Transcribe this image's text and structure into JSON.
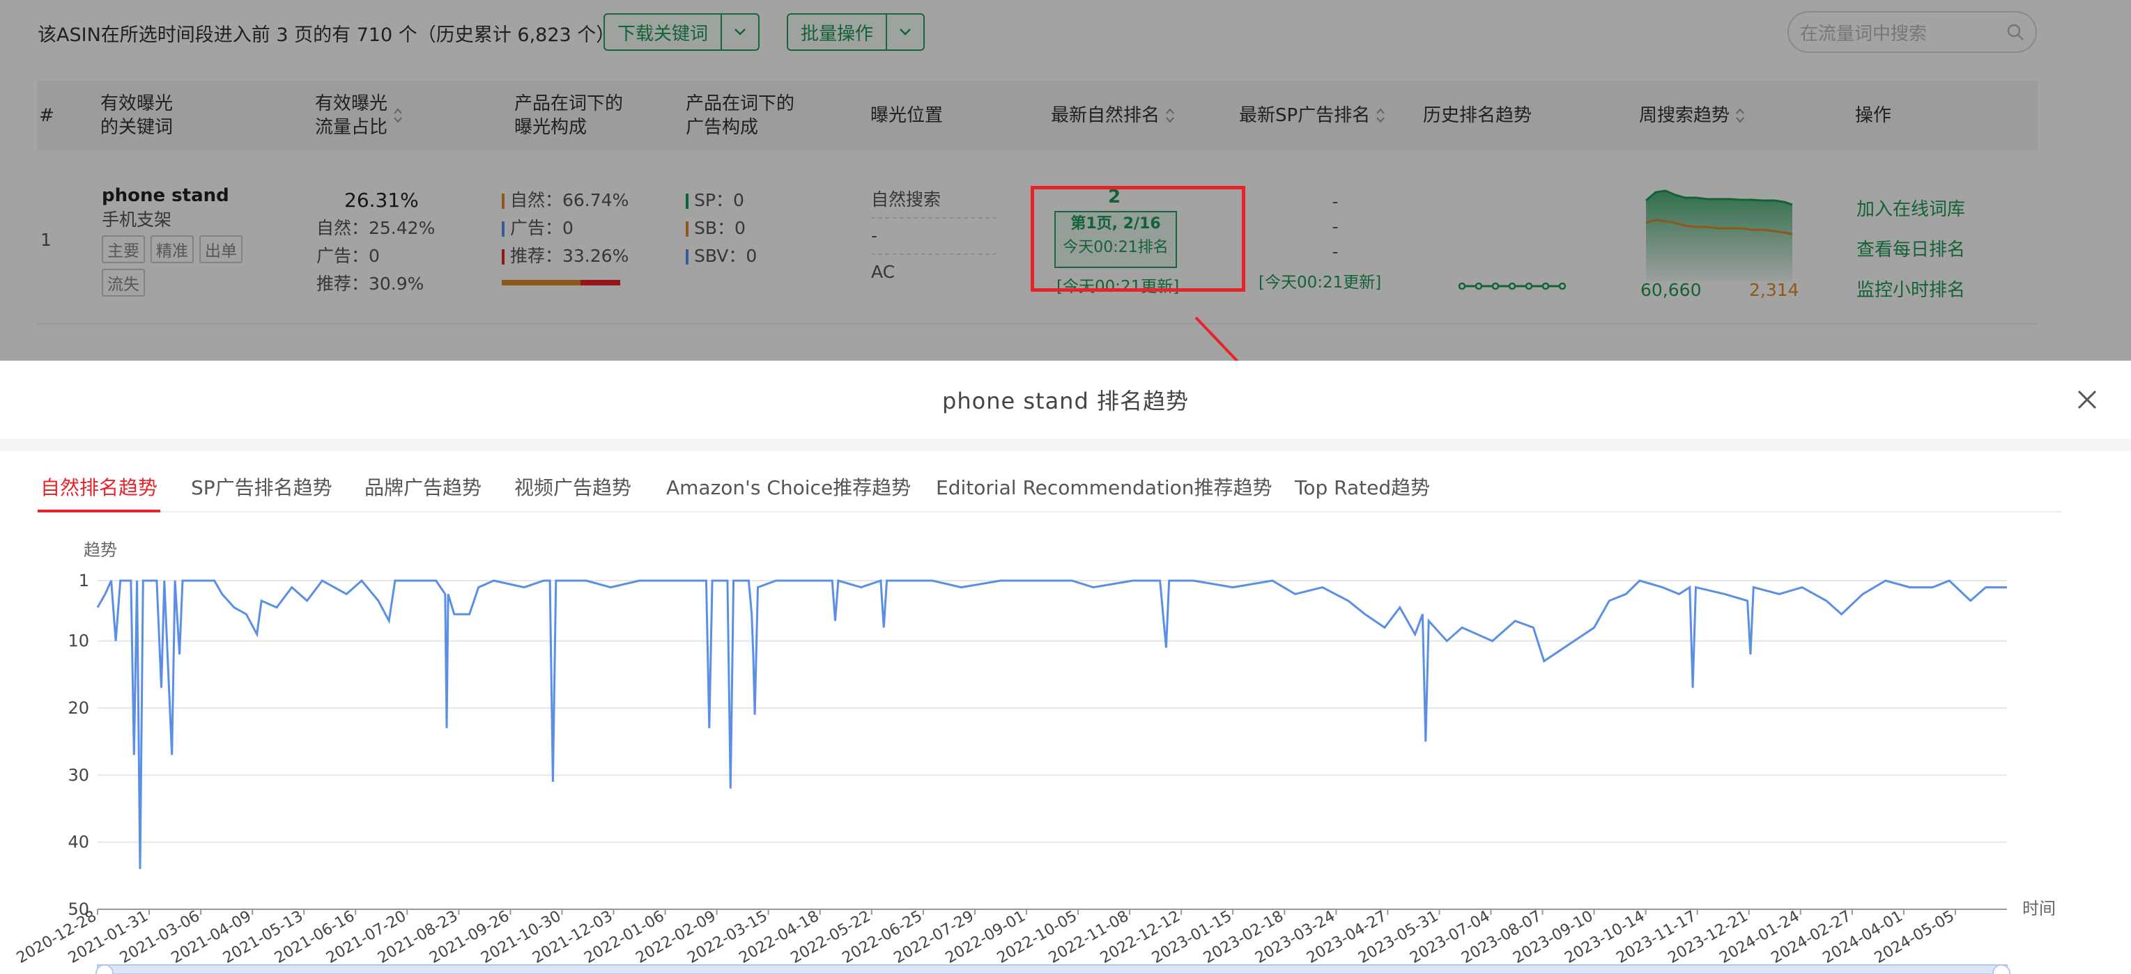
{
  "background": {
    "summary": "该ASIN在所选时间段进入前 3 页的有 710 个（历史累计 6,823 个）",
    "download_btn": "下载关键词",
    "batch_btn": "批量操作",
    "search_placeholder": "在流量词中搜索",
    "headers": [
      "#",
      "有效曝光\n的关键词",
      "有效曝光\n流量占比",
      "产品在词下的\n曝光构成",
      "产品在词下的\n广告构成",
      "曝光位置",
      "最新自然排名",
      "最新SP广告排名",
      "历史排名趋势",
      "周搜索趋势",
      "操作"
    ],
    "row": {
      "index": "1",
      "keyword": "phone stand",
      "keyword_cn": "手机支架",
      "tags": [
        "主要",
        "精准",
        "出单",
        "流失"
      ],
      "share": "26.31%",
      "share_natural": "自然：25.42%",
      "share_ad": "广告：0",
      "share_rec": "推荐：30.9%",
      "exp_natural": "自然：66.74%",
      "exp_ad": "广告：0",
      "exp_rec": "推荐：33.26%",
      "ad_sp": "SP：0",
      "ad_sb": "SB：0",
      "ad_sbv": "SBV：0",
      "pos_1": "自然搜索",
      "pos_2": "-",
      "pos_3": "AC",
      "rank_value": "2",
      "rank_page": "第1页, 2/16",
      "rank_time": "今天00:21排名",
      "rank_updated": "[今天00:21更新]",
      "sp_1": "-",
      "sp_2": "-",
      "sp_3": "-",
      "sp_updated": "[今天00:21更新]",
      "weekly_a": "60,660",
      "weekly_b": "2,314",
      "ops": [
        "加入在线词库",
        "查看每日排名",
        "监控小时排名"
      ]
    }
  },
  "modal": {
    "title": "phone stand 排名趋势",
    "tabs": [
      "自然排名趋势",
      "SP广告排名趋势",
      "品牌广告趋势",
      "视频广告趋势",
      "Amazon's Choice推荐趋势",
      "Editorial Recommendation推荐趋势",
      "Top Rated趋势"
    ],
    "active_tab": 0
  },
  "colors": {
    "accent_red": "#e8232a",
    "brand_green": "#1f9a55",
    "line_blue": "#5b8fe6",
    "orange": "#e08a2b"
  },
  "chart_data": {
    "type": "line",
    "ylabel": "趋势",
    "xlabel": "时间",
    "y_inverted": true,
    "yticks": [
      1,
      10,
      20,
      30,
      40,
      50
    ],
    "ylim": [
      1,
      50
    ],
    "xlim": [
      "2020-12-28",
      "2024-06-08"
    ],
    "xticks": [
      "2020-12-28",
      "2021-01-31",
      "2021-03-06",
      "2021-04-09",
      "2021-05-13",
      "2021-06-16",
      "2021-07-20",
      "2021-08-23",
      "2021-09-26",
      "2021-10-30",
      "2021-12-03",
      "2022-01-06",
      "2022-02-09",
      "2022-03-15",
      "2022-04-18",
      "2022-05-22",
      "2022-06-25",
      "2022-07-29",
      "2022-09-01",
      "2022-10-05",
      "2022-11-08",
      "2022-12-12",
      "2023-01-15",
      "2023-02-18",
      "2023-03-24",
      "2023-04-27",
      "2023-05-31",
      "2023-07-04",
      "2023-08-07",
      "2023-09-10",
      "2023-10-14",
      "2023-11-17",
      "2023-12-21",
      "2024-01-24",
      "2024-02-27",
      "2024-04-01",
      "2024-05-05"
    ],
    "grid": true,
    "series": [
      {
        "points": [
          [
            "2020-12-28",
            5
          ],
          [
            "2021-01-02",
            3
          ],
          [
            "2021-01-06",
            1
          ],
          [
            "2021-01-09",
            10
          ],
          [
            "2021-01-12",
            1
          ],
          [
            "2021-01-19",
            1
          ],
          [
            "2021-01-21",
            27
          ],
          [
            "2021-01-23",
            1
          ],
          [
            "2021-01-25",
            44
          ],
          [
            "2021-01-27",
            1
          ],
          [
            "2021-02-05",
            1
          ],
          [
            "2021-02-08",
            17
          ],
          [
            "2021-02-10",
            1
          ],
          [
            "2021-02-15",
            27
          ],
          [
            "2021-02-17",
            1
          ],
          [
            "2021-02-20",
            12
          ],
          [
            "2021-02-22",
            1
          ],
          [
            "2021-03-10",
            1
          ],
          [
            "2021-03-15",
            1
          ],
          [
            "2021-03-20",
            3
          ],
          [
            "2021-03-28",
            5
          ],
          [
            "2021-04-05",
            6
          ],
          [
            "2021-04-12",
            9
          ],
          [
            "2021-04-15",
            4
          ],
          [
            "2021-04-25",
            5
          ],
          [
            "2021-05-05",
            2
          ],
          [
            "2021-05-15",
            4
          ],
          [
            "2021-05-25",
            1
          ],
          [
            "2021-06-10",
            3
          ],
          [
            "2021-06-20",
            1
          ],
          [
            "2021-07-01",
            4
          ],
          [
            "2021-07-08",
            7
          ],
          [
            "2021-07-12",
            1
          ],
          [
            "2021-07-25",
            1
          ],
          [
            "2021-08-08",
            1
          ],
          [
            "2021-08-14",
            3
          ],
          [
            "2021-08-15",
            23
          ],
          [
            "2021-08-16",
            3
          ],
          [
            "2021-08-20",
            6
          ],
          [
            "2021-08-30",
            6
          ],
          [
            "2021-09-05",
            2
          ],
          [
            "2021-09-15",
            1
          ],
          [
            "2021-10-05",
            2
          ],
          [
            "2021-10-18",
            1
          ],
          [
            "2021-10-22",
            1
          ],
          [
            "2021-10-24",
            31
          ],
          [
            "2021-10-26",
            1
          ],
          [
            "2021-11-15",
            1
          ],
          [
            "2021-12-01",
            2
          ],
          [
            "2021-12-20",
            1
          ],
          [
            "2022-01-20",
            1
          ],
          [
            "2022-02-02",
            1
          ],
          [
            "2022-02-04",
            23
          ],
          [
            "2022-02-06",
            1
          ],
          [
            "2022-02-16",
            1
          ],
          [
            "2022-02-18",
            32
          ],
          [
            "2022-02-20",
            1
          ],
          [
            "2022-03-02",
            1
          ],
          [
            "2022-03-04",
            6
          ],
          [
            "2022-03-05",
            12
          ],
          [
            "2022-03-06",
            21
          ],
          [
            "2022-03-08",
            2
          ],
          [
            "2022-03-20",
            1
          ],
          [
            "2022-04-15",
            1
          ],
          [
            "2022-04-26",
            1
          ],
          [
            "2022-04-28",
            7
          ],
          [
            "2022-04-30",
            1
          ],
          [
            "2022-05-15",
            2
          ],
          [
            "2022-05-28",
            1
          ],
          [
            "2022-05-30",
            8
          ],
          [
            "2022-06-01",
            1
          ],
          [
            "2022-07-01",
            1
          ],
          [
            "2022-07-20",
            2
          ],
          [
            "2022-08-15",
            1
          ],
          [
            "2022-09-10",
            1
          ],
          [
            "2022-10-01",
            1
          ],
          [
            "2022-10-15",
            2
          ],
          [
            "2022-11-10",
            1
          ],
          [
            "2022-11-28",
            1
          ],
          [
            "2022-12-02",
            11
          ],
          [
            "2022-12-04",
            1
          ],
          [
            "2022-12-20",
            1
          ],
          [
            "2023-01-15",
            2
          ],
          [
            "2023-02-10",
            1
          ],
          [
            "2023-02-25",
            3
          ],
          [
            "2023-03-15",
            2
          ],
          [
            "2023-04-01",
            4
          ],
          [
            "2023-04-12",
            6
          ],
          [
            "2023-04-25",
            8
          ],
          [
            "2023-05-05",
            5
          ],
          [
            "2023-05-15",
            9
          ],
          [
            "2023-05-20",
            6
          ],
          [
            "2023-05-22",
            25
          ],
          [
            "2023-05-24",
            7
          ],
          [
            "2023-06-05",
            10
          ],
          [
            "2023-06-15",
            8
          ],
          [
            "2023-07-05",
            10
          ],
          [
            "2023-07-20",
            7
          ],
          [
            "2023-08-01",
            8
          ],
          [
            "2023-08-08",
            13
          ],
          [
            "2023-09-10",
            8
          ],
          [
            "2023-09-20",
            4
          ],
          [
            "2023-10-01",
            3
          ],
          [
            "2023-10-10",
            1
          ],
          [
            "2023-10-25",
            2
          ],
          [
            "2023-11-05",
            3
          ],
          [
            "2023-11-12",
            2
          ],
          [
            "2023-11-14",
            17
          ],
          [
            "2023-11-16",
            2
          ],
          [
            "2023-12-05",
            3
          ],
          [
            "2023-12-20",
            4
          ],
          [
            "2023-12-22",
            12
          ],
          [
            "2023-12-24",
            2
          ],
          [
            "2024-01-10",
            3
          ],
          [
            "2024-01-25",
            2
          ],
          [
            "2024-02-10",
            4
          ],
          [
            "2024-02-20",
            6
          ],
          [
            "2024-03-05",
            3
          ],
          [
            "2024-03-20",
            1
          ],
          [
            "2024-04-05",
            2
          ],
          [
            "2024-04-20",
            2
          ],
          [
            "2024-05-01",
            1
          ],
          [
            "2024-05-15",
            4
          ],
          [
            "2024-05-25",
            2
          ],
          [
            "2024-06-08",
            2
          ]
        ]
      }
    ]
  }
}
